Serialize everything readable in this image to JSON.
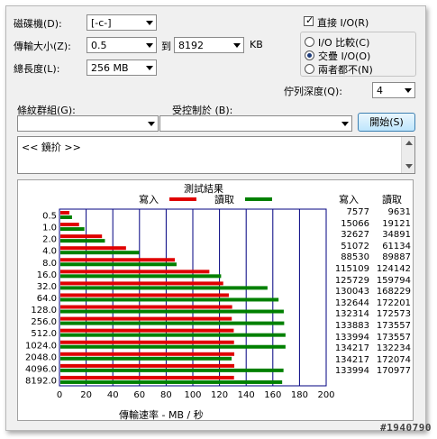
{
  "drive": {
    "label": "磁碟機(D):",
    "value": "[-c-]"
  },
  "transfer_size": {
    "label": "傳輸大小(Z):",
    "from": "0.5",
    "to_label": "到",
    "to": "8192",
    "unit": "KB"
  },
  "total_length": {
    "label": "總長度(L):",
    "value": "256 MB"
  },
  "direct_io": {
    "label": "直接 I/O(R)",
    "checked": true
  },
  "io_mode": {
    "options": [
      {
        "label": "I/O 比較(C)",
        "selected": false
      },
      {
        "label": "交疊 I/O(O)",
        "selected": true
      },
      {
        "label": "兩者都不(N)",
        "selected": false
      }
    ]
  },
  "queue_depth": {
    "label": "佇列深度(Q):",
    "value": "4"
  },
  "pattern": {
    "label": "條紋群組(G):",
    "value": ""
  },
  "controlled_by": {
    "label": "受控制於 (B):",
    "value": ""
  },
  "start_button": {
    "label": "開始(S)"
  },
  "description": {
    "text": "<< 鏡扴 >>"
  },
  "results": {
    "title": "測試結果",
    "legend_write": "寫入",
    "legend_read": "讀取",
    "col_write": "寫入",
    "col_read": "讀取",
    "xlabel": "傳輸速率 - MB / 秒",
    "rows": [
      {
        "size": "0.5",
        "write": "7577",
        "read": "9631"
      },
      {
        "size": "1.0",
        "write": "15066",
        "read": "19121"
      },
      {
        "size": "2.0",
        "write": "32627",
        "read": "34891"
      },
      {
        "size": "4.0",
        "write": "51072",
        "read": "61134"
      },
      {
        "size": "8.0",
        "write": "88530",
        "read": "89887"
      },
      {
        "size": "16.0",
        "write": "115109",
        "read": "124142"
      },
      {
        "size": "32.0",
        "write": "125729",
        "read": "159794"
      },
      {
        "size": "64.0",
        "write": "130043",
        "read": "168229"
      },
      {
        "size": "128.0",
        "write": "132644",
        "read": "172201"
      },
      {
        "size": "256.0",
        "write": "132314",
        "read": "172573"
      },
      {
        "size": "512.0",
        "write": "133883",
        "read": "173557"
      },
      {
        "size": "1024.0",
        "write": "133994",
        "read": "173557"
      },
      {
        "size": "2048.0",
        "write": "134217",
        "read": "132234"
      },
      {
        "size": "4096.0",
        "write": "134217",
        "read": "172074"
      },
      {
        "size": "8192.0",
        "write": "133994",
        "read": "170977"
      }
    ]
  },
  "chart_data": {
    "type": "bar",
    "title": "測試結果",
    "xlabel": "傳輸速率 - MB / 秒",
    "ylabel": "",
    "xlim": [
      0,
      200
    ],
    "xticks": [
      "0",
      "20",
      "40",
      "60",
      "80",
      "100",
      "120",
      "140",
      "160",
      "180",
      "200"
    ],
    "categories": [
      "0.5",
      "1.0",
      "2.0",
      "4.0",
      "8.0",
      "16.0",
      "32.0",
      "64.0",
      "128.0",
      "256.0",
      "512.0",
      "1024.0",
      "2048.0",
      "4096.0",
      "8192.0"
    ],
    "series": [
      {
        "name": "寫入",
        "color": "#e00000",
        "values": [
          7.4,
          14.7,
          31.9,
          49.9,
          86.5,
          112.4,
          122.8,
          127.0,
          129.5,
          129.2,
          130.7,
          130.9,
          131.1,
          131.1,
          130.9
        ]
      },
      {
        "name": "讀取",
        "color": "#008000",
        "values": [
          9.4,
          18.7,
          34.1,
          59.7,
          87.8,
          121.2,
          156.0,
          164.3,
          168.2,
          168.5,
          169.5,
          169.5,
          129.1,
          168.0,
          167.0
        ]
      }
    ],
    "grid": true,
    "legend": "top"
  },
  "watermark": "#1940790",
  "colors": {
    "write": "#e00000",
    "read": "#008000",
    "grid": "#000080"
  }
}
